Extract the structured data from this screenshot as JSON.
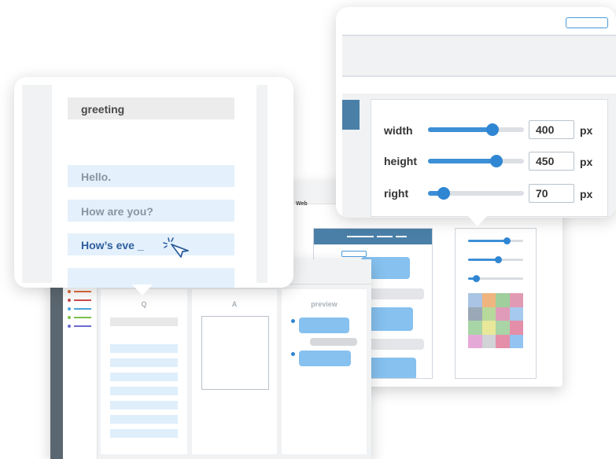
{
  "back_window": {
    "tab_label": "Web",
    "palette": [
      "#a9c4e4",
      "#f0b57e",
      "#9ecf9d",
      "#e19ab3",
      "#9ba8b6",
      "#b7d99b",
      "#e09bb9",
      "#a6c9ee",
      "#a8d5a5",
      "#e8e79a",
      "#a8d4a6",
      "#e58ea9",
      "#e5a9d8",
      "#d1d3d6",
      "#e58ea9",
      "#93c3f0"
    ],
    "sliders": [
      0.7,
      0.55,
      0.15
    ]
  },
  "editor": {
    "columns": {
      "q": "Q",
      "a": "A",
      "preview": "preview"
    },
    "tag_colors": [
      "#e06b3a",
      "#d14b4b",
      "#4aa3d9",
      "#7dc04b",
      "#6b6bd1"
    ]
  },
  "greeting_card": {
    "title": "greeting",
    "messages": [
      "Hello.",
      "How are you?",
      "How’s eve _"
    ]
  },
  "size_card": {
    "fields": [
      {
        "label": "width",
        "value": "400",
        "unit": "px",
        "level": 0.67
      },
      {
        "label": "height",
        "value": "450",
        "unit": "px",
        "level": 0.71
      },
      {
        "label": "right",
        "value": "70",
        "unit": "px",
        "level": 0.16
      }
    ]
  }
}
